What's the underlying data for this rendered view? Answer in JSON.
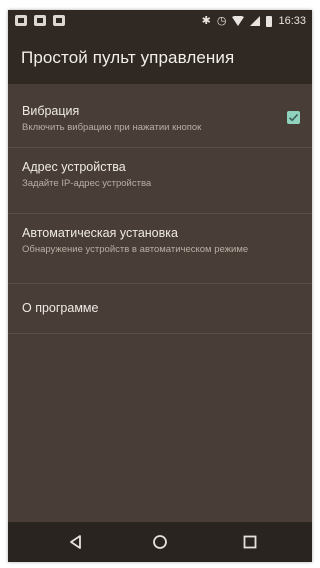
{
  "status_bar": {
    "left_icons": [
      "notification-icon",
      "mail-icon",
      "media-icon"
    ],
    "bluetooth": "✱",
    "alarm": "◷",
    "time": "16:33"
  },
  "toolbar": {
    "title": "Простой пульт управления"
  },
  "settings": {
    "vibration": {
      "title": "Вибрация",
      "summary": "Включить вибрацию при нажатии кнопок",
      "checked": true
    },
    "device_address": {
      "title": "Адрес устройства",
      "summary": "Задайте IP-адрес устройства"
    },
    "auto_setup": {
      "title": "Автоматическая установка",
      "summary": "Обнаружение устройств в автоматическом режиме"
    },
    "about": {
      "title": "О программе"
    }
  },
  "nav_bar": {
    "buttons": [
      "back-icon",
      "home-icon",
      "recents-icon"
    ]
  },
  "colors": {
    "background": "#493e37",
    "toolbar": "#2f2823",
    "accent": "#8fd3be"
  }
}
